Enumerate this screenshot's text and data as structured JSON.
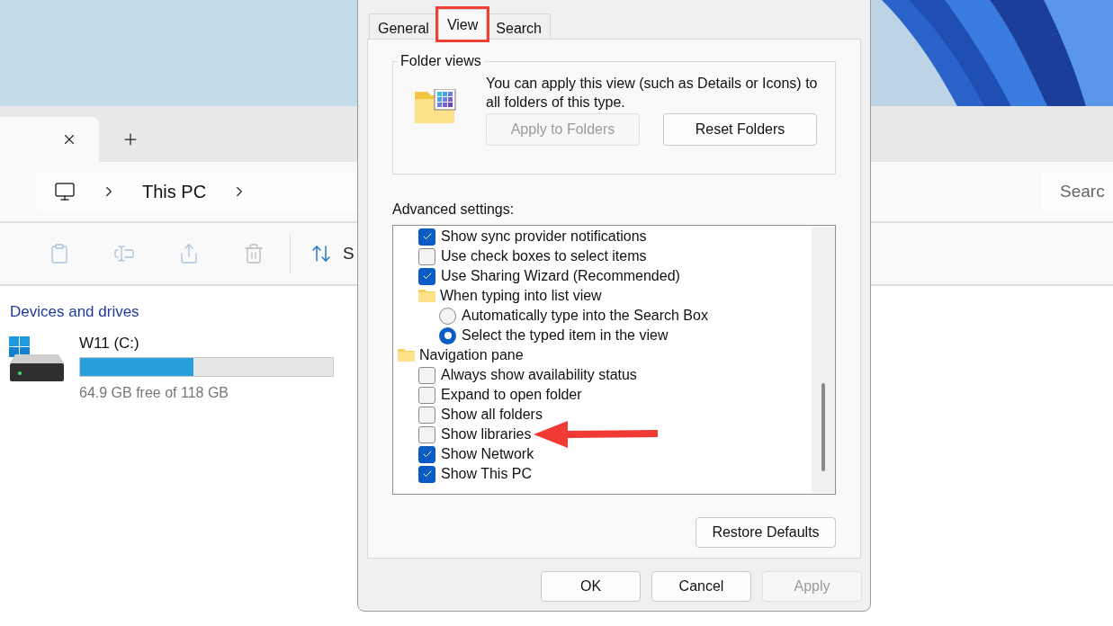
{
  "explorer": {
    "tabs": [
      {
        "selected": true
      }
    ],
    "breadcrumb": [
      "This PC"
    ],
    "search": {
      "placeholder": "Searc"
    },
    "sort_label": "S",
    "section_title": "Devices and drives",
    "drives": [
      {
        "name": "W11 (C:)",
        "level": 0.45,
        "free": "64.9 GB free of 118 GB"
      }
    ]
  },
  "dialog": {
    "tabs": [
      {
        "label": "General",
        "selected": false,
        "highlighted": false
      },
      {
        "label": "View",
        "selected": true,
        "highlighted": true
      },
      {
        "label": "Search",
        "selected": false,
        "highlighted": false
      }
    ],
    "folder_views": {
      "title": "Folder views",
      "description": "You can apply this view (such as Details or Icons) to all folders of this type.",
      "buttons": [
        {
          "label": "Apply to Folders",
          "disabled": true
        },
        {
          "label": "Reset Folders",
          "disabled": false
        }
      ]
    },
    "advanced_label": "Advanced settings:",
    "settings": [
      {
        "kind": "continued",
        "children": [
          {
            "kind": "checkbox",
            "label": "Show sync provider notifications",
            "checked": true,
            "arrow": false
          },
          {
            "kind": "checkbox",
            "label": "Use check boxes to select items",
            "checked": false,
            "arrow": false
          },
          {
            "kind": "checkbox",
            "label": "Use Sharing Wizard (Recommended)",
            "checked": true,
            "arrow": false
          },
          {
            "kind": "folder",
            "label": "When typing into list view",
            "children": [
              {
                "kind": "radio",
                "label": "Automatically type into the Search Box",
                "selected": false
              },
              {
                "kind": "radio",
                "label": "Select the typed item in the view",
                "selected": true
              }
            ]
          }
        ]
      },
      {
        "kind": "group",
        "label": "Navigation pane",
        "children": [
          {
            "kind": "checkbox",
            "label": "Always show availability status",
            "checked": false,
            "arrow": false
          },
          {
            "kind": "checkbox",
            "label": "Expand to open folder",
            "checked": false,
            "arrow": false
          },
          {
            "kind": "checkbox",
            "label": "Show all folders",
            "checked": false,
            "arrow": false
          },
          {
            "kind": "checkbox",
            "label": "Show libraries",
            "checked": false,
            "arrow": true
          },
          {
            "kind": "checkbox",
            "label": "Show Network",
            "checked": true,
            "arrow": false
          },
          {
            "kind": "checkbox",
            "label": "Show This PC",
            "checked": true,
            "arrow": false
          }
        ]
      }
    ],
    "restore_button": "Restore Defaults",
    "buttons": [
      {
        "label": "OK",
        "disabled": false
      },
      {
        "label": "Cancel",
        "disabled": false
      },
      {
        "label": "Apply",
        "disabled": true
      }
    ]
  }
}
